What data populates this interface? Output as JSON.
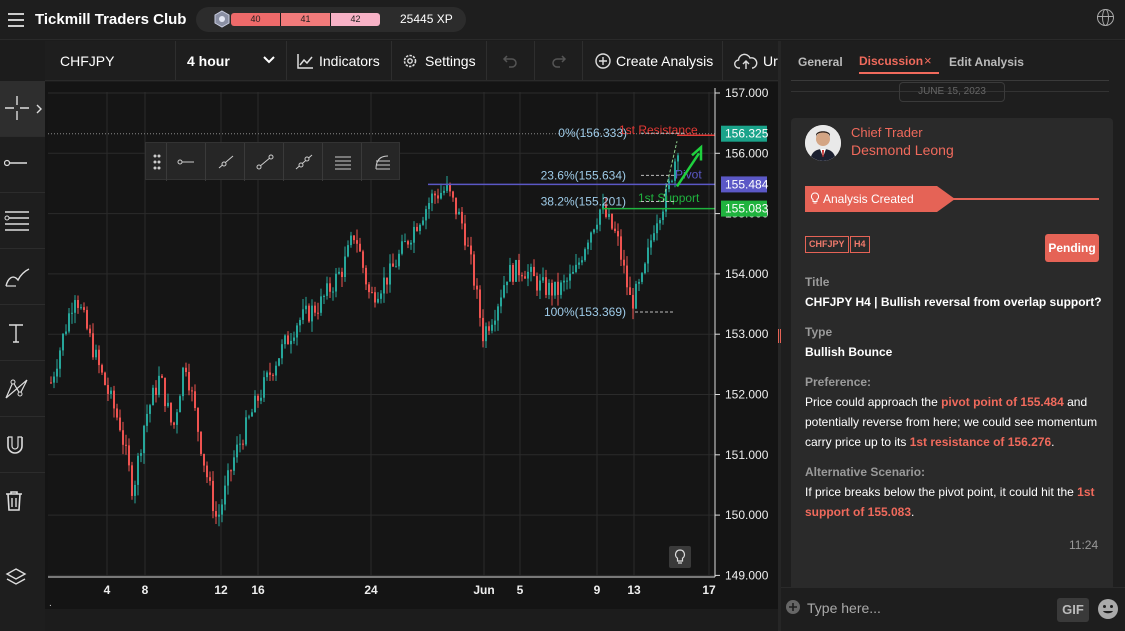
{
  "header": {
    "title": "Tickmill Traders Club",
    "xp_levels": [
      "40",
      "41",
      "42"
    ],
    "xp": "25445 XP"
  },
  "toolbar": {
    "symbol": "CHFJPY",
    "timeframe": "4 hour",
    "indicators": "Indicators",
    "settings": "Settings",
    "create_analysis": "Create Analysis",
    "upload": "Ur"
  },
  "left_tools": [
    "crosshair-icon",
    "line-icon",
    "fib-icon",
    "brush-icon",
    "text-icon",
    "pattern-icon",
    "magnet-icon",
    "trash-icon",
    "layers-icon"
  ],
  "chart": {
    "y_ticks": [
      "157.000",
      "156.000",
      "155.000",
      "154.000",
      "153.000",
      "152.000",
      "151.000",
      "150.000",
      "149.000"
    ],
    "x_ticks": [
      "4",
      "8",
      "12",
      "16",
      "24",
      "Jun",
      "5",
      "9",
      "13",
      "17"
    ],
    "price_tags": [
      {
        "value": "156.325",
        "color": "#1aa38a"
      },
      {
        "value": "155.484",
        "color": "#5b58c6"
      },
      {
        "value": "155.083",
        "color": "#1fb33e"
      }
    ],
    "fib_labels": [
      "0%(156.333)",
      "23.6%(155.634)",
      "38.2%(155.201)",
      "100%(153.369)"
    ],
    "level_labels": {
      "resistance": "1st Resistance",
      "pivot": "Pivot",
      "support": "1st Support"
    },
    "colors": {
      "up": "#26a69a",
      "down": "#ef5350",
      "resistance": "#e53935",
      "pivot": "#5b58c6",
      "support": "#1fb33e",
      "arrow": "#1fd13e"
    }
  },
  "panel": {
    "tabs": [
      "General",
      "Discussion",
      "Edit Analysis"
    ],
    "active_tab": "Discussion",
    "date": "JUNE 15, 2023",
    "author_role": "Chief Trader",
    "author_name": "Desmond Leong",
    "status_banner": "Analysis Created",
    "tags": [
      "CHFJPY",
      "H4"
    ],
    "status": "Pending",
    "title_label": "Title",
    "title_value": "CHFJPY H4 | Bullish reversal from overlap support?",
    "type_label": "Type",
    "type_value": "Bullish Bounce",
    "preference_label": "Preference:",
    "pref_t1": "Price could approach the ",
    "pref_h1": "pivot point of 155.484",
    "pref_t2": " and potentially reverse from here; we could see momentum carry price up to its ",
    "pref_h2": "1st resistance of 156.276",
    "pref_t3": ".",
    "alt_label": "Alternative Scenario:",
    "alt_t1": "If price breaks below the pivot point, it could hit the ",
    "alt_h1": "1st support of 155.083",
    "alt_t2": ".",
    "time": "11:24",
    "input_placeholder": "Type here...",
    "gif_label": "GIF"
  }
}
